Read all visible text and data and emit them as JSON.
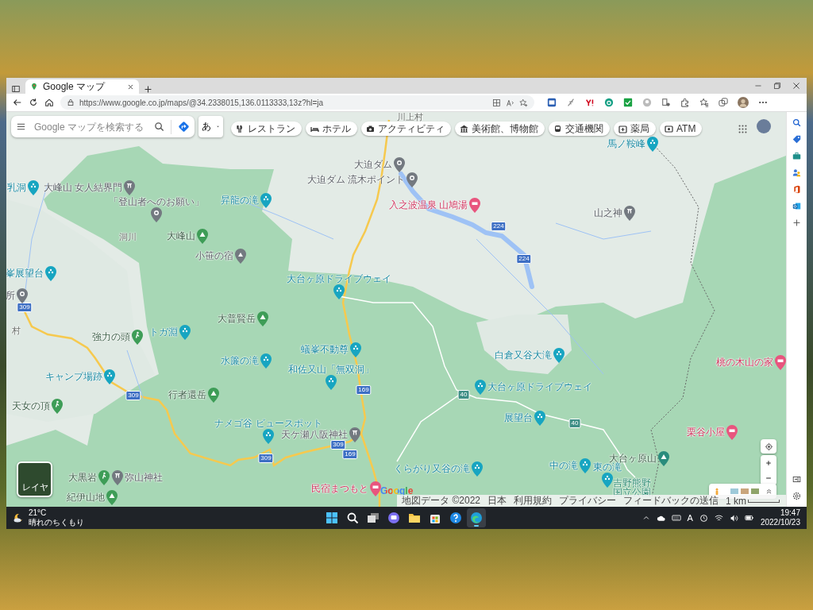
{
  "browser": {
    "tab": {
      "title": "Google マップ"
    },
    "url": "https://www.google.co.jp/maps/@34.2338015,136.0113333,13z?hl=ja"
  },
  "map": {
    "search": {
      "placeholder": "Google マップを検索する"
    },
    "ime_button": "あ",
    "chips": [
      {
        "kind": "restaurant",
        "label": "レストラン"
      },
      {
        "kind": "hotel",
        "label": "ホテル"
      },
      {
        "kind": "activity",
        "label": "アクティビティ"
      },
      {
        "kind": "museum",
        "label": "美術館、博物館"
      },
      {
        "kind": "transit",
        "label": "交通機関"
      },
      {
        "kind": "pharmacy",
        "label": "薬局"
      },
      {
        "kind": "atm",
        "label": "ATM"
      }
    ],
    "places": [
      {
        "kind": "area",
        "name": "川上村"
      },
      {
        "kind": "scenic",
        "name": "馬ノ鞍峰"
      },
      {
        "kind": "pin",
        "name": "大迫ダム"
      },
      {
        "kind": "pin",
        "name": "大迫ダム 流木ポイント"
      },
      {
        "kind": "scenic",
        "name": "乳洞"
      },
      {
        "kind": "temple",
        "name": "大峰山 女人結界門"
      },
      {
        "kind": "scenic",
        "name": "昇龍の滝"
      },
      {
        "kind": "pin",
        "name": "「登山者へのお願い」"
      },
      {
        "kind": "hotel",
        "name": "入之波温泉 山鳩湯"
      },
      {
        "kind": "area",
        "name": "洞川"
      },
      {
        "kind": "shrine",
        "name": "山之神"
      },
      {
        "kind": "mountain",
        "name": "大峰山"
      },
      {
        "kind": "lodge",
        "name": "小笹の宿"
      },
      {
        "kind": "scenic",
        "name": "峯展望台"
      },
      {
        "kind": "scenic",
        "name": "大台ヶ原ドライブウェイ"
      },
      {
        "kind": "pin",
        "name": "所"
      },
      {
        "kind": "area",
        "name": "村"
      },
      {
        "kind": "mountain",
        "name": "大普賢岳"
      },
      {
        "kind": "hiking",
        "name": "強力の頭"
      },
      {
        "kind": "scenic",
        "name": "トガ淵"
      },
      {
        "kind": "scenic",
        "name": "蟻峯不動尊"
      },
      {
        "kind": "scenic",
        "name": "水簾の滝"
      },
      {
        "kind": "scenic",
        "name": "和佐又山「無双洞」"
      },
      {
        "kind": "scenic",
        "name": "白倉又谷大滝"
      },
      {
        "kind": "hotel",
        "name": "桃の木山の家"
      },
      {
        "kind": "scenic",
        "name": "キャンプ場跡"
      },
      {
        "kind": "scenic",
        "name": "大台ヶ原ドライブウェイ"
      },
      {
        "kind": "mountain",
        "name": "行者還岳"
      },
      {
        "kind": "hiking",
        "name": "天女の頂"
      },
      {
        "kind": "scenic",
        "name": "展望台"
      },
      {
        "kind": "scenic",
        "name": "ナメゴ谷 ビュースポット"
      },
      {
        "kind": "shrine",
        "name": "天ケ瀬八阪神社"
      },
      {
        "kind": "hotel",
        "name": "栗谷小屋"
      },
      {
        "kind": "summit",
        "name": "大台ヶ原山"
      },
      {
        "kind": "scenic",
        "name": "くらがり又谷の滝"
      },
      {
        "kind": "scenic",
        "name": "中の滝"
      },
      {
        "kind": "scenic",
        "name": "東の滝"
      },
      {
        "kind": "park",
        "name": "吉野熊野国立公園"
      },
      {
        "kind": "hiking",
        "name": "大黒岩"
      },
      {
        "kind": "shrine",
        "name": "弥山神社"
      },
      {
        "kind": "mountain",
        "name": "紀伊山地"
      },
      {
        "kind": "hotel",
        "name": "民宿まつもと"
      }
    ],
    "road_shields": [
      {
        "kind": "national",
        "label": "309"
      },
      {
        "kind": "national",
        "label": "309"
      },
      {
        "kind": "national",
        "label": "309"
      },
      {
        "kind": "national",
        "label": "309"
      },
      {
        "kind": "national",
        "label": "169"
      },
      {
        "kind": "national",
        "label": "169"
      },
      {
        "kind": "national",
        "label": "224"
      },
      {
        "kind": "national",
        "label": "224"
      },
      {
        "kind": "prefectural",
        "label": "40"
      },
      {
        "kind": "prefectural",
        "label": "40"
      }
    ],
    "layer_button": "レイヤ",
    "logo": "Google",
    "attribution": [
      "地図データ ©2022",
      "日本",
      "利用規約",
      "プライバシー",
      "フィードバックの送信"
    ],
    "scale": "1 km"
  },
  "taskbar": {
    "weather": {
      "temperature": "21°C",
      "condition": "晴れのちくもり"
    },
    "apps": [
      {
        "kind": "start",
        "selected": false
      },
      {
        "kind": "search",
        "selected": false
      },
      {
        "kind": "taskview",
        "selected": false
      },
      {
        "kind": "chat",
        "selected": false
      },
      {
        "kind": "explorer",
        "selected": false
      },
      {
        "kind": "store",
        "selected": false
      },
      {
        "kind": "help",
        "selected": false
      },
      {
        "kind": "browser",
        "selected": true
      }
    ],
    "ime_indicator": "A",
    "time": "19:47",
    "date": "2022/10/23"
  }
}
